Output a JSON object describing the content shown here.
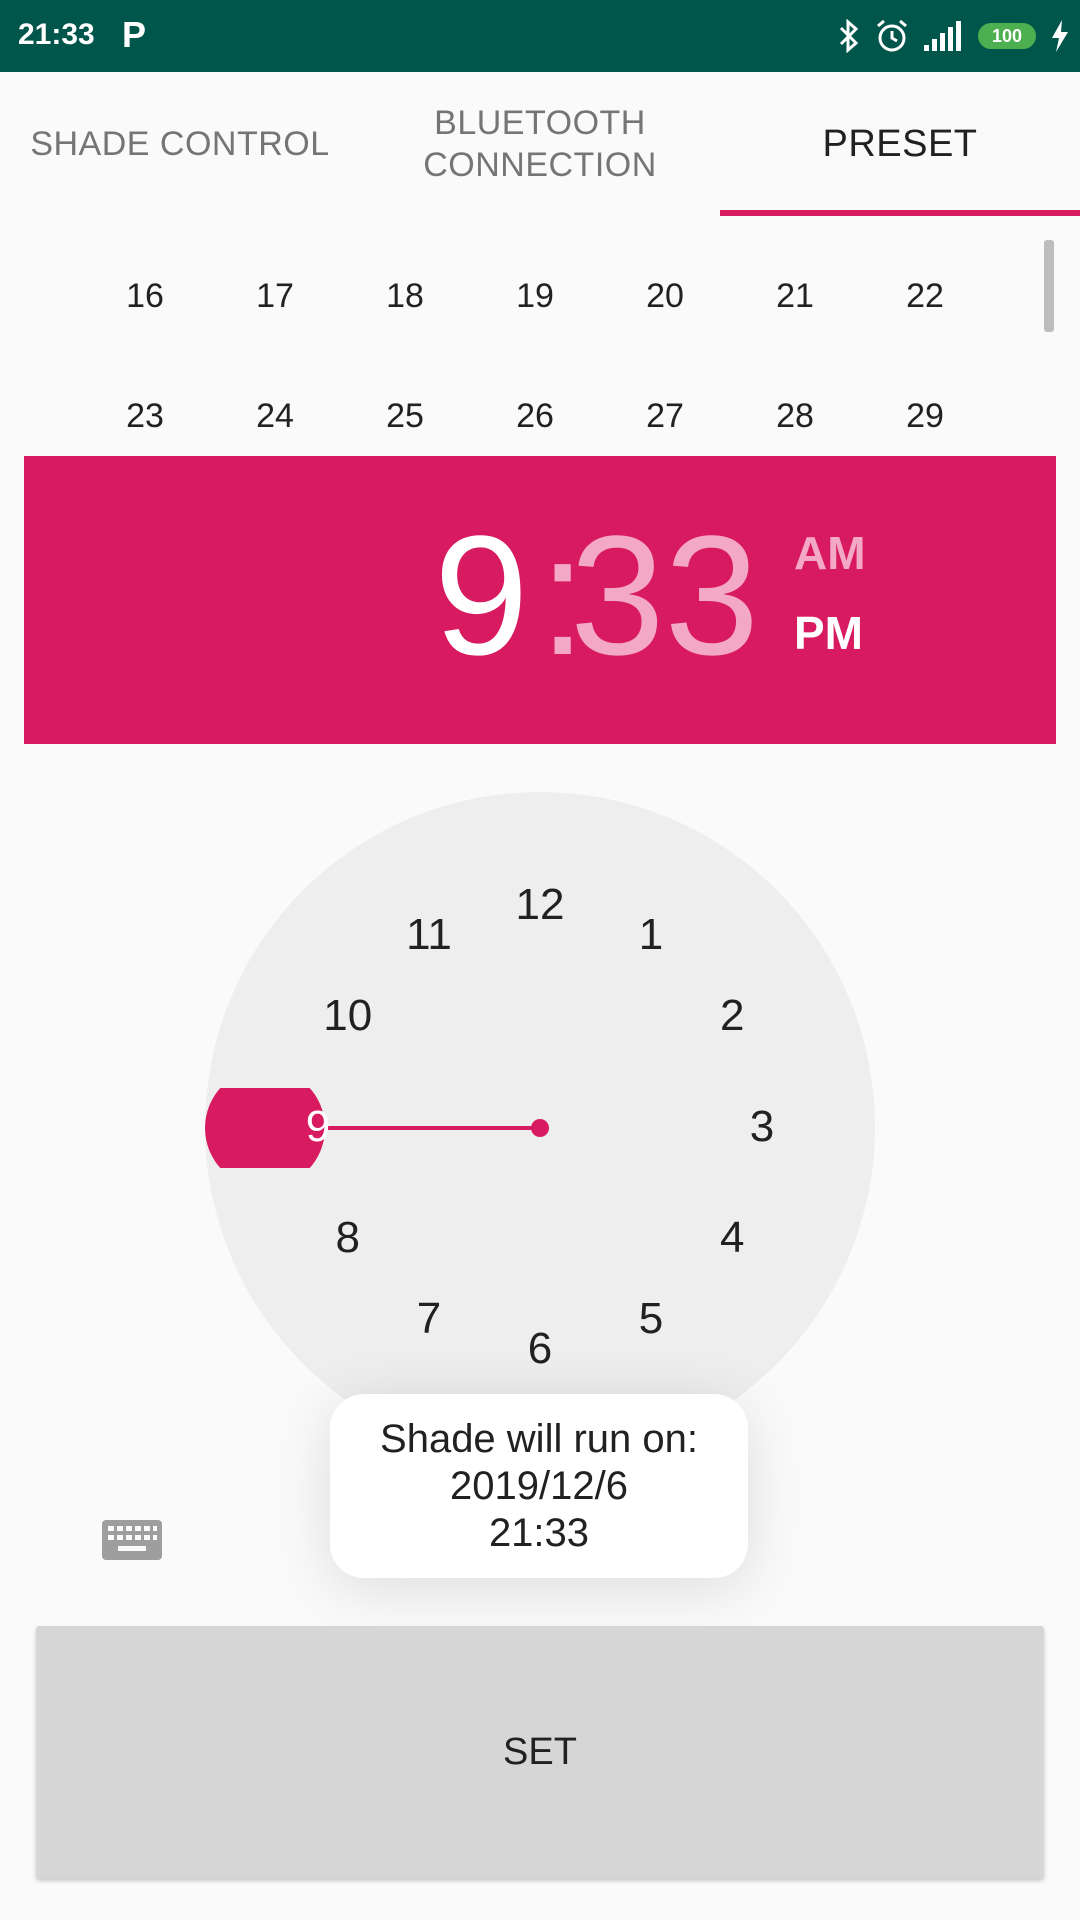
{
  "status_bar": {
    "time": "21:33",
    "notification_icon": "P",
    "battery": "100",
    "icons": [
      "bluetooth-icon",
      "alarm-icon",
      "signal-icon",
      "battery-icon",
      "charging-icon"
    ]
  },
  "tabs": [
    {
      "label": "SHADE CONTROL",
      "selected": false
    },
    {
      "label": "BLUETOOTH CONNECTION",
      "selected": false
    },
    {
      "label": "PRESET",
      "selected": true
    }
  ],
  "calendar": {
    "rows": [
      [
        "16",
        "17",
        "18",
        "19",
        "20",
        "21",
        "22"
      ],
      [
        "23",
        "24",
        "25",
        "26",
        "27",
        "28",
        "29"
      ]
    ]
  },
  "time_picker": {
    "hour": "9",
    "colon": ":",
    "minute": "33",
    "am": "AM",
    "pm": "PM",
    "clock_numbers": [
      "12",
      "1",
      "2",
      "3",
      "4",
      "5",
      "6",
      "7",
      "8",
      "9",
      "10",
      "11"
    ],
    "selected_hour": "9"
  },
  "toast": {
    "line1": "Shade will run on:",
    "line2": "2019/12/6",
    "line3": "21:33"
  },
  "set_button": "SET",
  "colors": {
    "accent": "#d81b60",
    "status_bar": "#00564a"
  }
}
